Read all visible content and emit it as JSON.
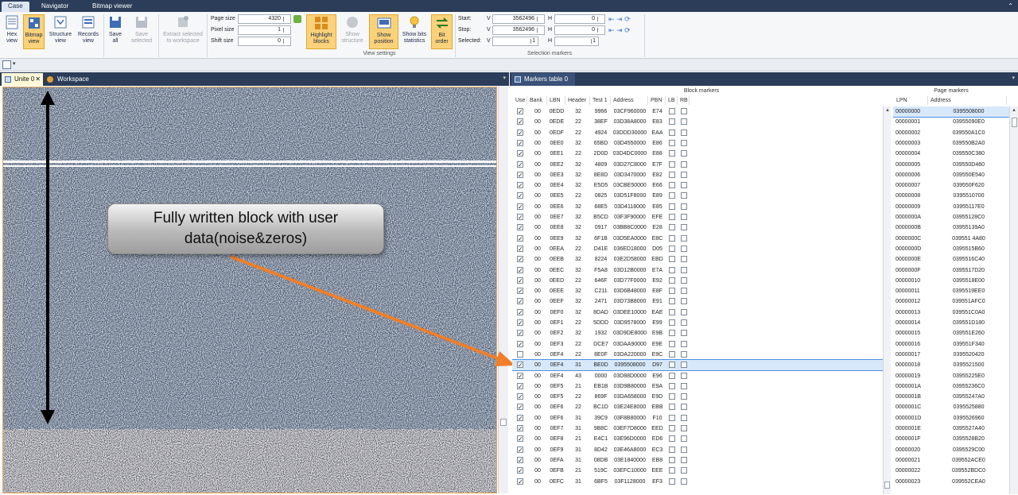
{
  "menu": {
    "tabs": [
      "Case",
      "Navigator",
      "Bitmap viewer"
    ]
  },
  "ribbon": {
    "buttons": {
      "hex_view": "Hex view",
      "bitmap_view": "Bitmap view",
      "structure_view": "Structure view",
      "records_view": "Records view",
      "save_all": "Save all",
      "save_selected": "Save selected",
      "extract": "Extract selected to workspace",
      "highlight_blocks": "Highlight blocks",
      "show_structure": "Show structure",
      "show_position": "Show position",
      "show_bits": "Show bits statistics",
      "bit_order": "Bit order"
    },
    "view_settings": {
      "label": "View settings",
      "page_size_label": "Page size",
      "page_size": "4320",
      "pixel_size_label": "Pixel size",
      "pixel_size": "1",
      "shift_size_label": "Shift size",
      "shift_size": "0"
    },
    "selection": {
      "label": "Selection markers",
      "start_label": "Start:",
      "stop_label": "Stop:",
      "selected_label": "Selected:",
      "v": "V",
      "h": "H",
      "start_v": "3562496",
      "start_h": "0",
      "stop_v": "3562496",
      "stop_h": "0",
      "sel_v": "1",
      "sel_h": "1"
    }
  },
  "doc_tabs": {
    "left": [
      "Unite 0",
      "Workspace"
    ],
    "right": [
      "Markers table 0"
    ]
  },
  "callout": {
    "line1": "Fully written block with user",
    "line2": "data(noise&zeros)"
  },
  "block_markers": {
    "title": "Block markers",
    "columns": [
      "Use",
      "Bank",
      "LBN",
      "Header",
      "Test 1",
      "Address",
      "PBN",
      "LB",
      "RB"
    ],
    "rows": [
      [
        "00",
        "0EDD",
        "32",
        "9966",
        "03CF960000",
        "E74",
        1
      ],
      [
        "00",
        "0EDE",
        "22",
        "38EF",
        "03D38A8000",
        "E83",
        1
      ],
      [
        "00",
        "0EDF",
        "22",
        "4924",
        "03DDD30000",
        "EAA",
        1
      ],
      [
        "00",
        "0EE0",
        "32",
        "65BD",
        "03D4550000",
        "E86",
        1
      ],
      [
        "00",
        "0EE1",
        "22",
        "2D0D",
        "03D4DC0000",
        "E88",
        1
      ],
      [
        "00",
        "0EE2",
        "32",
        "4809",
        "03D27C8000",
        "E7F",
        1
      ],
      [
        "00",
        "0EE3",
        "32",
        "8E8D",
        "03D3470000",
        "E82",
        1
      ],
      [
        "00",
        "0EE4",
        "32",
        "E5D5",
        "03CBE50000",
        "E66",
        1
      ],
      [
        "00",
        "0EE5",
        "22",
        "0825",
        "03D51F8000",
        "E89",
        1
      ],
      [
        "00",
        "0EE6",
        "32",
        "68E5",
        "03D4118000",
        "E85",
        1
      ],
      [
        "00",
        "0EE7",
        "32",
        "B5CD",
        "03F3F90000",
        "EFE",
        1
      ],
      [
        "00",
        "0EE8",
        "32",
        "0917",
        "03BB8C0000",
        "E28",
        1
      ],
      [
        "00",
        "0EE9",
        "32",
        "6F1B",
        "03D5EA0000",
        "E8C",
        1
      ],
      [
        "00",
        "0EEA",
        "22",
        "D41E",
        "036ED18000",
        "D05",
        1
      ],
      [
        "00",
        "0EEB",
        "32",
        "8224",
        "03E2D58000",
        "EBD",
        1
      ],
      [
        "00",
        "0EEC",
        "32",
        "F5A8",
        "03D12B0000",
        "E7A",
        1
      ],
      [
        "00",
        "0EED",
        "22",
        "646F",
        "03D77F0000",
        "E92",
        1
      ],
      [
        "00",
        "0EEE",
        "32",
        "C211",
        "03D6B48000",
        "E8F",
        1
      ],
      [
        "00",
        "0EEF",
        "32",
        "2471",
        "03D73B8000",
        "E91",
        1
      ],
      [
        "00",
        "0EF0",
        "32",
        "8DAD",
        "03DEE10000",
        "EAE",
        1
      ],
      [
        "00",
        "0EF1",
        "22",
        "5DDD",
        "03D9578000",
        "E99",
        1
      ],
      [
        "00",
        "0EF2",
        "32",
        "1932",
        "03D9DE8000",
        "E9B",
        1
      ],
      [
        "00",
        "0EF3",
        "22",
        "DCE7",
        "03DAA90000",
        "E9E",
        1
      ],
      [
        "00",
        "0EF4",
        "22",
        "8E0F",
        "03DA220000",
        "E9C",
        0
      ],
      [
        "00",
        "0EF4",
        "31",
        "BE0D",
        "0395508000",
        "D97",
        1
      ],
      [
        "00",
        "0EF4",
        "43",
        "0000",
        "03D88D0000",
        "E96",
        1
      ],
      [
        "00",
        "0EF5",
        "21",
        "EB1B",
        "03D9B80000",
        "E9A",
        1
      ],
      [
        "00",
        "0EF5",
        "22",
        "869F",
        "03DA658000",
        "E9D",
        1
      ],
      [
        "00",
        "0EF6",
        "22",
        "BC1D",
        "03E24E8000",
        "EBB",
        1
      ],
      [
        "00",
        "0EF6",
        "31",
        "39C9",
        "03F8B80000",
        "F10",
        1
      ],
      [
        "00",
        "0EF7",
        "31",
        "9B8C",
        "03EF7D8000",
        "EED",
        1
      ],
      [
        "00",
        "0EF8",
        "21",
        "E4C1",
        "03E96D0000",
        "ED6",
        1
      ],
      [
        "00",
        "0EF9",
        "31",
        "8D42",
        "03E46A8000",
        "EC3",
        1
      ],
      [
        "00",
        "0EFA",
        "31",
        "08DB",
        "03E1840000",
        "EB8",
        1
      ],
      [
        "00",
        "0EFB",
        "21",
        "519C",
        "03EFC10000",
        "EEE",
        1
      ],
      [
        "00",
        "0EFC",
        "31",
        "6BF5",
        "03F1128000",
        "EF3",
        1
      ]
    ]
  },
  "page_markers": {
    "title": "Page markers",
    "columns": [
      "LPN",
      "Address"
    ],
    "rows": [
      [
        "00000000",
        "0395508000"
      ],
      [
        "00000001",
        "03955090E0"
      ],
      [
        "00000002",
        "039550A1C0"
      ],
      [
        "00000003",
        "039550B2A0"
      ],
      [
        "00000004",
        "039550C380"
      ],
      [
        "00000005",
        "039550D460"
      ],
      [
        "00000006",
        "039550E540"
      ],
      [
        "00000007",
        "039550F620"
      ],
      [
        "00000008",
        "0395510700"
      ],
      [
        "00000009",
        "03955117E0"
      ],
      [
        "0000000A",
        "03955128C0"
      ],
      [
        "0000000B",
        "03955139A0"
      ],
      [
        "0000000C",
        "039551 4A80"
      ],
      [
        "0000000D",
        "0395515B60"
      ],
      [
        "0000000E",
        "0395516C40"
      ],
      [
        "0000000F",
        "0395517D20"
      ],
      [
        "00000010",
        "0395518E00"
      ],
      [
        "00000011",
        "0395519EE0"
      ],
      [
        "00000012",
        "039551AFC0"
      ],
      [
        "00000013",
        "039551C0A0"
      ],
      [
        "00000014",
        "039551D180"
      ],
      [
        "00000015",
        "039551E260"
      ],
      [
        "00000016",
        "039551F340"
      ],
      [
        "00000017",
        "0395520420"
      ],
      [
        "00000018",
        "0395521500"
      ],
      [
        "00000019",
        "03955225E0"
      ],
      [
        "0000001A",
        "03955236C0"
      ],
      [
        "0000001B",
        "03955247A0"
      ],
      [
        "0000001C",
        "0395525880"
      ],
      [
        "0000001D",
        "0395526960"
      ],
      [
        "0000001E",
        "0395527A40"
      ],
      [
        "0000001F",
        "0395528B20"
      ],
      [
        "00000020",
        "0395529C00"
      ],
      [
        "00000021",
        "039552ACE0"
      ],
      [
        "00000022",
        "039552BDC0"
      ],
      [
        "00000023",
        "039552CEA0"
      ]
    ]
  },
  "colors": {
    "accent": "#2b3d59",
    "active_button": "#fbd27a",
    "arrow": "#ef7f2a",
    "selection": "#d8e8fb"
  }
}
